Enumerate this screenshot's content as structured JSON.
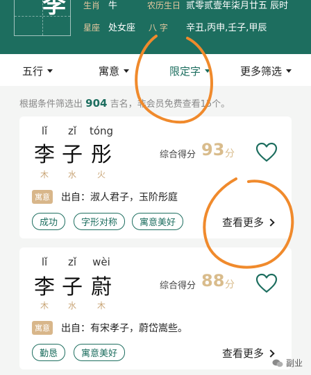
{
  "header": {
    "surname": "李",
    "zodiac_label": "生肖",
    "zodiac_value": "牛",
    "lunar_label": "农历生日",
    "lunar_value": "贰零贰壹年柒月廿五 辰时",
    "star_label": "星座",
    "star_value": "处女座",
    "bazi_label": "八 字",
    "bazi_value": "辛丑,丙申,壬子,甲辰"
  },
  "filters": [
    {
      "label": "五行",
      "active": false
    },
    {
      "label": "寓意",
      "active": false
    },
    {
      "label": "限定字",
      "active": true
    },
    {
      "label": "更多筛选",
      "active": false
    }
  ],
  "summary": {
    "prefix": "根据条件筛选出",
    "count": "904",
    "suffix": "吉名，非会员免费查看15个。"
  },
  "cards": [
    {
      "chars": [
        {
          "pinyin": "lǐ",
          "hanzi": "李",
          "wuxing": "木"
        },
        {
          "pinyin": "zǐ",
          "hanzi": "子",
          "wuxing": "水"
        },
        {
          "pinyin": "tóng",
          "hanzi": "彤",
          "wuxing": "火"
        }
      ],
      "score_label": "综合得分",
      "score": "93",
      "score_unit": "分",
      "meaning_tag": "寓意",
      "meaning": "出自：淑人君子，玉阶彤庭",
      "chips": [
        "成功",
        "字形对称",
        "寓意美好"
      ],
      "more": "查看更多"
    },
    {
      "chars": [
        {
          "pinyin": "lǐ",
          "hanzi": "李",
          "wuxing": "木"
        },
        {
          "pinyin": "zǐ",
          "hanzi": "子",
          "wuxing": "水"
        },
        {
          "pinyin": "wèi",
          "hanzi": "蔚",
          "wuxing": "木"
        }
      ],
      "score_label": "综合得分",
      "score": "88",
      "score_unit": "分",
      "meaning_tag": "寓意",
      "meaning": "出自：有宋孝子，蔚岱嵩些。",
      "chips": [
        "勤恳",
        "寓意美好"
      ],
      "more": "查看更多"
    }
  ],
  "watermark": "副业",
  "colors": {
    "primary": "#1d6e5f",
    "accent": "#d9bc8c",
    "annotation": "#f08a2c"
  }
}
